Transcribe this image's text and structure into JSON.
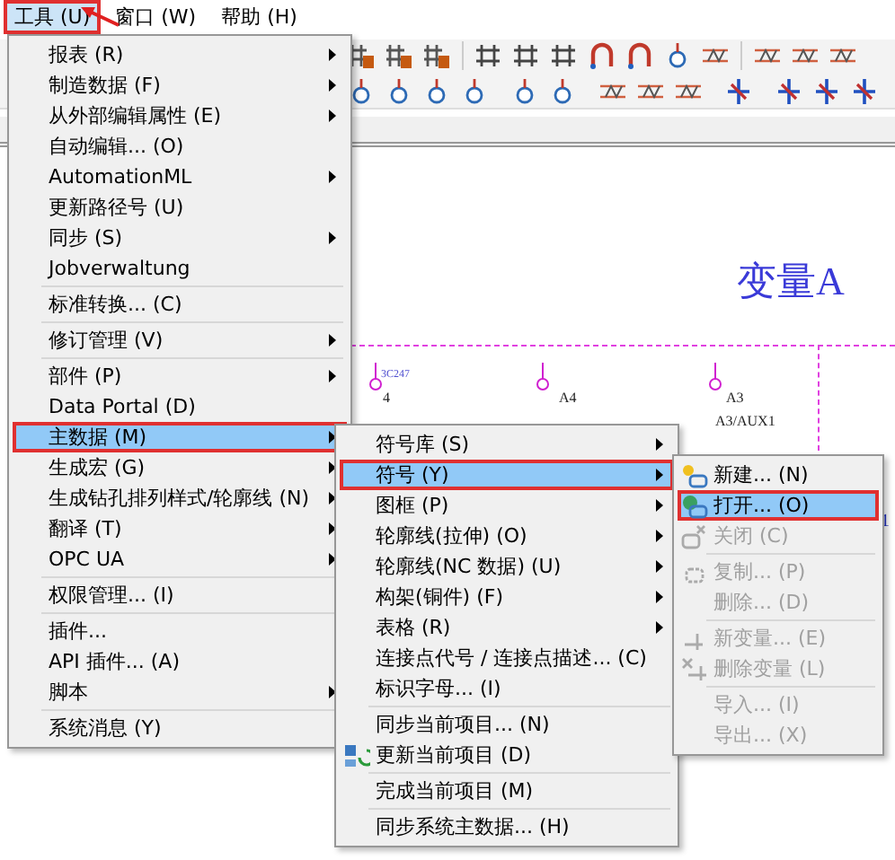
{
  "menubar": [
    {
      "label": "工具 (U)",
      "selected": true,
      "highlighted": true
    },
    {
      "label": "窗口 (W)",
      "selected": false,
      "highlighted": false
    },
    {
      "label": "帮助 (H)",
      "selected": false,
      "highlighted": false
    }
  ],
  "canvas": {
    "title": "变量A",
    "labels": [
      {
        "text": "3C247"
      },
      {
        "text": "4"
      },
      {
        "text": "A4"
      },
      {
        "text": "A3"
      },
      {
        "text": "A3/AUX1"
      },
      {
        "text": "1"
      }
    ]
  },
  "menus": [
    {
      "items": [
        {
          "kind": "item",
          "label": "报表 (R)",
          "submenu": true,
          "selected": false,
          "highlighted": false,
          "disabled": false
        },
        {
          "kind": "item",
          "label": "制造数据 (F)",
          "submenu": true,
          "selected": false,
          "highlighted": false,
          "disabled": false
        },
        {
          "kind": "item",
          "label": "从外部编辑属性 (E)",
          "submenu": true,
          "selected": false,
          "highlighted": false,
          "disabled": false
        },
        {
          "kind": "item",
          "label": "自动编辑... (O)",
          "submenu": false,
          "selected": false,
          "highlighted": false,
          "disabled": false
        },
        {
          "kind": "item",
          "label": "AutomationML",
          "submenu": true,
          "selected": false,
          "highlighted": false,
          "disabled": false
        },
        {
          "kind": "item",
          "label": "更新路径号 (U)",
          "submenu": false,
          "selected": false,
          "highlighted": false,
          "disabled": false
        },
        {
          "kind": "item",
          "label": "同步 (S)",
          "submenu": true,
          "selected": false,
          "highlighted": false,
          "disabled": false
        },
        {
          "kind": "item",
          "label": "Jobverwaltung",
          "submenu": false,
          "selected": false,
          "highlighted": false,
          "disabled": false
        },
        {
          "kind": "separator"
        },
        {
          "kind": "item",
          "label": "标准转换... (C)",
          "submenu": false,
          "selected": false,
          "highlighted": false,
          "disabled": false
        },
        {
          "kind": "separator"
        },
        {
          "kind": "item",
          "label": "修订管理 (V)",
          "submenu": true,
          "selected": false,
          "highlighted": false,
          "disabled": false
        },
        {
          "kind": "separator"
        },
        {
          "kind": "item",
          "label": "部件 (P)",
          "submenu": true,
          "selected": false,
          "highlighted": false,
          "disabled": false
        },
        {
          "kind": "item",
          "label": "Data Portal (D)",
          "submenu": false,
          "selected": false,
          "highlighted": false,
          "disabled": false
        },
        {
          "kind": "item",
          "label": "主数据 (M)",
          "submenu": true,
          "selected": true,
          "highlighted": true,
          "disabled": false
        },
        {
          "kind": "item",
          "label": "生成宏 (G)",
          "submenu": true,
          "selected": false,
          "highlighted": false,
          "disabled": false
        },
        {
          "kind": "item",
          "label": "生成钻孔排列样式/轮廓线 (N)",
          "submenu": true,
          "selected": false,
          "highlighted": false,
          "disabled": false
        },
        {
          "kind": "item",
          "label": "翻译 (T)",
          "submenu": true,
          "selected": false,
          "highlighted": false,
          "disabled": false
        },
        {
          "kind": "item",
          "label": "OPC UA",
          "submenu": true,
          "selected": false,
          "highlighted": false,
          "disabled": false
        },
        {
          "kind": "separator"
        },
        {
          "kind": "item",
          "label": "权限管理... (I)",
          "submenu": false,
          "selected": false,
          "highlighted": false,
          "disabled": false
        },
        {
          "kind": "separator"
        },
        {
          "kind": "item",
          "label": "插件...",
          "submenu": false,
          "selected": false,
          "highlighted": false,
          "disabled": false
        },
        {
          "kind": "item",
          "label": "API 插件... (A)",
          "submenu": false,
          "selected": false,
          "highlighted": false,
          "disabled": false
        },
        {
          "kind": "item",
          "label": "脚本",
          "submenu": true,
          "selected": false,
          "highlighted": false,
          "disabled": false
        },
        {
          "kind": "separator"
        },
        {
          "kind": "item",
          "label": "系统消息 (Y)",
          "submenu": false,
          "selected": false,
          "highlighted": false,
          "disabled": false
        }
      ]
    },
    {
      "items": [
        {
          "kind": "item",
          "label": "符号库 (S)",
          "submenu": true,
          "selected": false,
          "highlighted": false,
          "disabled": false
        },
        {
          "kind": "item",
          "label": "符号 (Y)",
          "submenu": true,
          "selected": true,
          "highlighted": true,
          "disabled": false
        },
        {
          "kind": "item",
          "label": "图框 (P)",
          "submenu": true,
          "selected": false,
          "highlighted": false,
          "disabled": false
        },
        {
          "kind": "item",
          "label": "轮廓线(拉伸) (O)",
          "submenu": true,
          "selected": false,
          "highlighted": false,
          "disabled": false
        },
        {
          "kind": "item",
          "label": "轮廓线(NC 数据) (U)",
          "submenu": true,
          "selected": false,
          "highlighted": false,
          "disabled": false
        },
        {
          "kind": "item",
          "label": "构架(铜件) (F)",
          "submenu": true,
          "selected": false,
          "highlighted": false,
          "disabled": false
        },
        {
          "kind": "item",
          "label": "表格 (R)",
          "submenu": true,
          "selected": false,
          "highlighted": false,
          "disabled": false
        },
        {
          "kind": "item",
          "label": "连接点代号 / 连接点描述... (C)",
          "submenu": false,
          "selected": false,
          "highlighted": false,
          "disabled": false
        },
        {
          "kind": "item",
          "label": "标识字母... (I)",
          "submenu": false,
          "selected": false,
          "highlighted": false,
          "disabled": false
        },
        {
          "kind": "separator"
        },
        {
          "kind": "item",
          "label": "同步当前项目... (N)",
          "submenu": false,
          "selected": false,
          "highlighted": false,
          "disabled": false
        },
        {
          "kind": "item",
          "label": "更新当前项目 (D)",
          "submenu": false,
          "selected": false,
          "highlighted": false,
          "disabled": false
        },
        {
          "kind": "separator"
        },
        {
          "kind": "item",
          "label": "完成当前项目 (M)",
          "submenu": false,
          "selected": false,
          "highlighted": false,
          "disabled": false
        },
        {
          "kind": "separator"
        },
        {
          "kind": "item",
          "label": "同步系统主数据... (H)",
          "submenu": false,
          "selected": false,
          "highlighted": false,
          "disabled": false
        }
      ]
    },
    {
      "items": [
        {
          "kind": "item",
          "label": "新建... (N)",
          "submenu": false,
          "selected": false,
          "highlighted": false,
          "disabled": false
        },
        {
          "kind": "item",
          "label": "打开... (O)",
          "submenu": false,
          "selected": true,
          "highlighted": true,
          "disabled": false
        },
        {
          "kind": "item",
          "label": "关闭 (C)",
          "submenu": false,
          "selected": false,
          "highlighted": false,
          "disabled": true
        },
        {
          "kind": "separator"
        },
        {
          "kind": "item",
          "label": "复制... (P)",
          "submenu": false,
          "selected": false,
          "highlighted": false,
          "disabled": true
        },
        {
          "kind": "item",
          "label": "删除... (D)",
          "submenu": false,
          "selected": false,
          "highlighted": false,
          "disabled": true
        },
        {
          "kind": "separator"
        },
        {
          "kind": "item",
          "label": "新变量... (E)",
          "submenu": false,
          "selected": false,
          "highlighted": false,
          "disabled": true
        },
        {
          "kind": "item",
          "label": "删除变量 (L)",
          "submenu": false,
          "selected": false,
          "highlighted": false,
          "disabled": true
        },
        {
          "kind": "separator"
        },
        {
          "kind": "item",
          "label": "导入... (I)",
          "submenu": false,
          "selected": false,
          "highlighted": false,
          "disabled": true
        },
        {
          "kind": "item",
          "label": "导出... (X)",
          "submenu": false,
          "selected": false,
          "highlighted": false,
          "disabled": true
        }
      ]
    }
  ]
}
